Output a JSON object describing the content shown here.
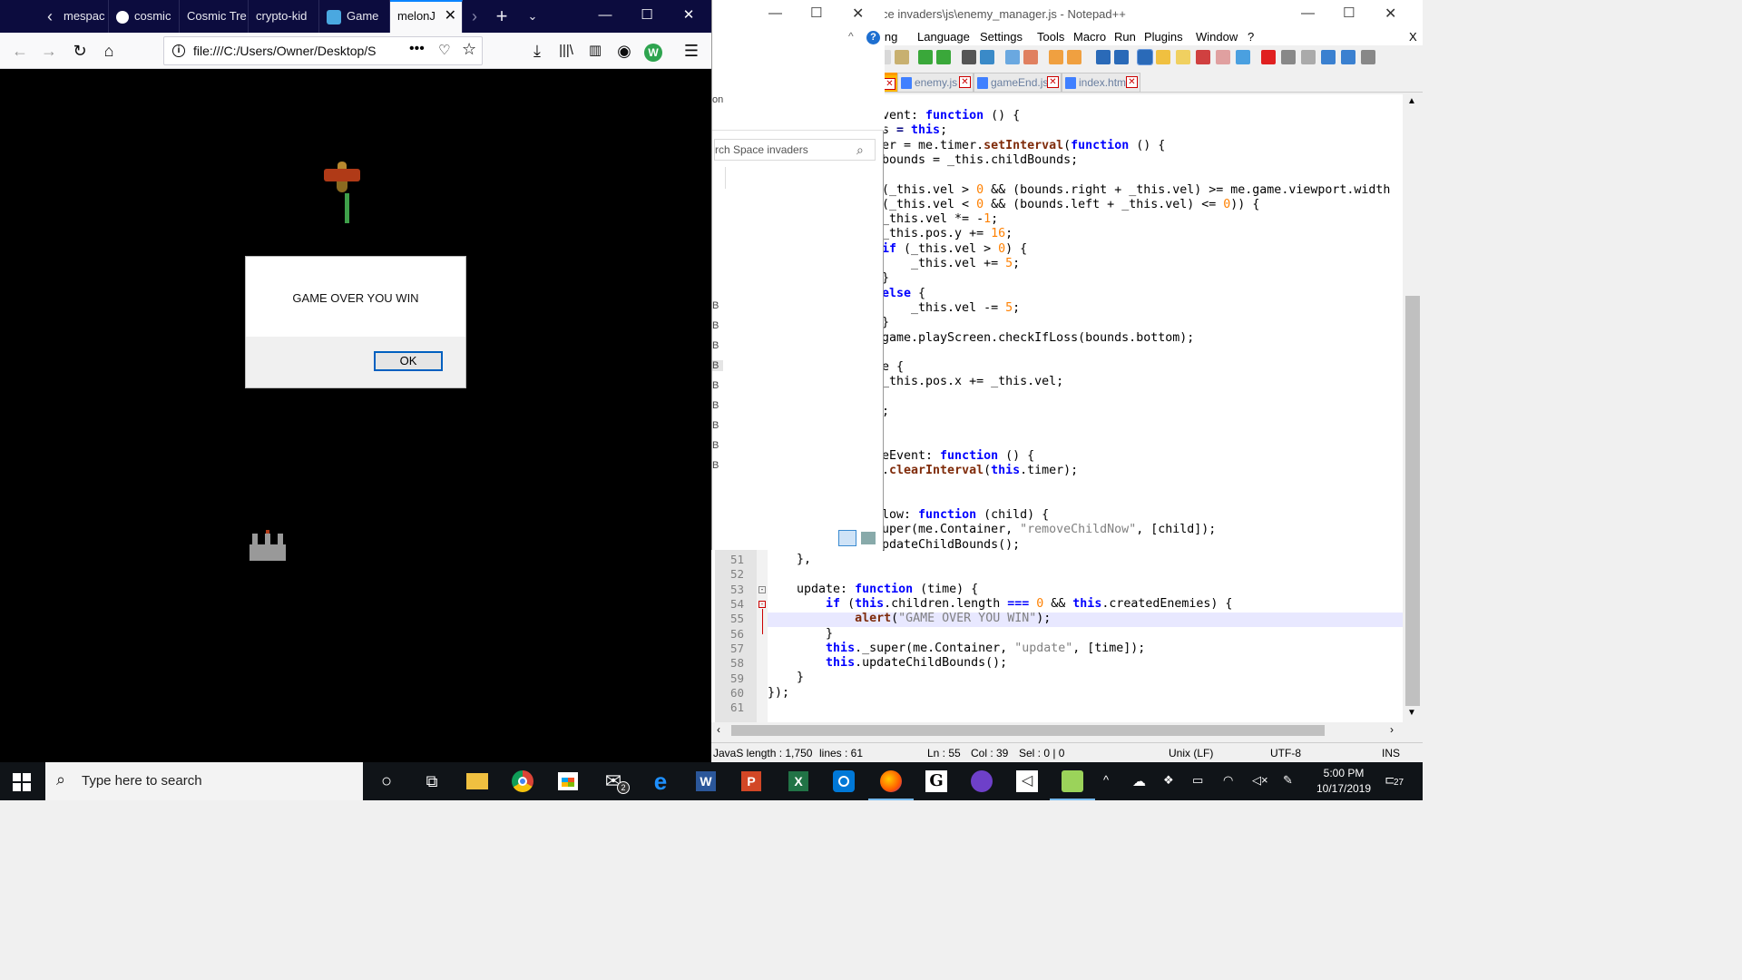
{
  "firefox": {
    "tabs": [
      {
        "label": "mespac"
      },
      {
        "label": "cosmic"
      },
      {
        "label": "Cosmic Tre"
      },
      {
        "label": "crypto-kid"
      },
      {
        "label": "Game"
      },
      {
        "label": "melonJ"
      }
    ],
    "url": "file:///C:/Users/Owner/Desktop/S",
    "alert": {
      "message": "GAME OVER YOU WIN",
      "ok_label": "OK"
    }
  },
  "explorer": {
    "search_placeholder": "rch Space invaders",
    "side_label": "on",
    "b_labels": [
      "B",
      "B",
      "B",
      "B",
      "B",
      "B",
      "B",
      "B",
      "B"
    ]
  },
  "notepadpp": {
    "title": "ce invaders\\js\\enemy_manager.js - Notepad++",
    "menu": [
      "ing",
      "Language",
      "Settings",
      "Tools",
      "Macro",
      "Run",
      "Plugins",
      "Window",
      "?"
    ],
    "close_x": "X",
    "tabs": [
      {
        "label": "s",
        "active": true
      },
      {
        "label": "enemy.js",
        "active": false
      },
      {
        "label": "gameEnd.js",
        "active": false
      },
      {
        "label": "index.html",
        "active": false
      }
    ],
    "line_numbers": [
      "51",
      "52",
      "53",
      "54",
      "55",
      "56",
      "57",
      "58",
      "59",
      "60",
      "61"
    ],
    "status": {
      "type_length": "JavaS length : 1,750",
      "lines": "lines : 61",
      "ln": "Ln : 55",
      "col": "Col : 39",
      "sel": "Sel : 0 | 0",
      "eol": "Unix (LF)",
      "encoding": "UTF-8",
      "ins": "INS"
    }
  },
  "taskbar": {
    "search_placeholder": "Type here to search",
    "mail_badge": "2",
    "notification_count": "27",
    "time": "5:00 PM",
    "date": "10/17/2019"
  }
}
